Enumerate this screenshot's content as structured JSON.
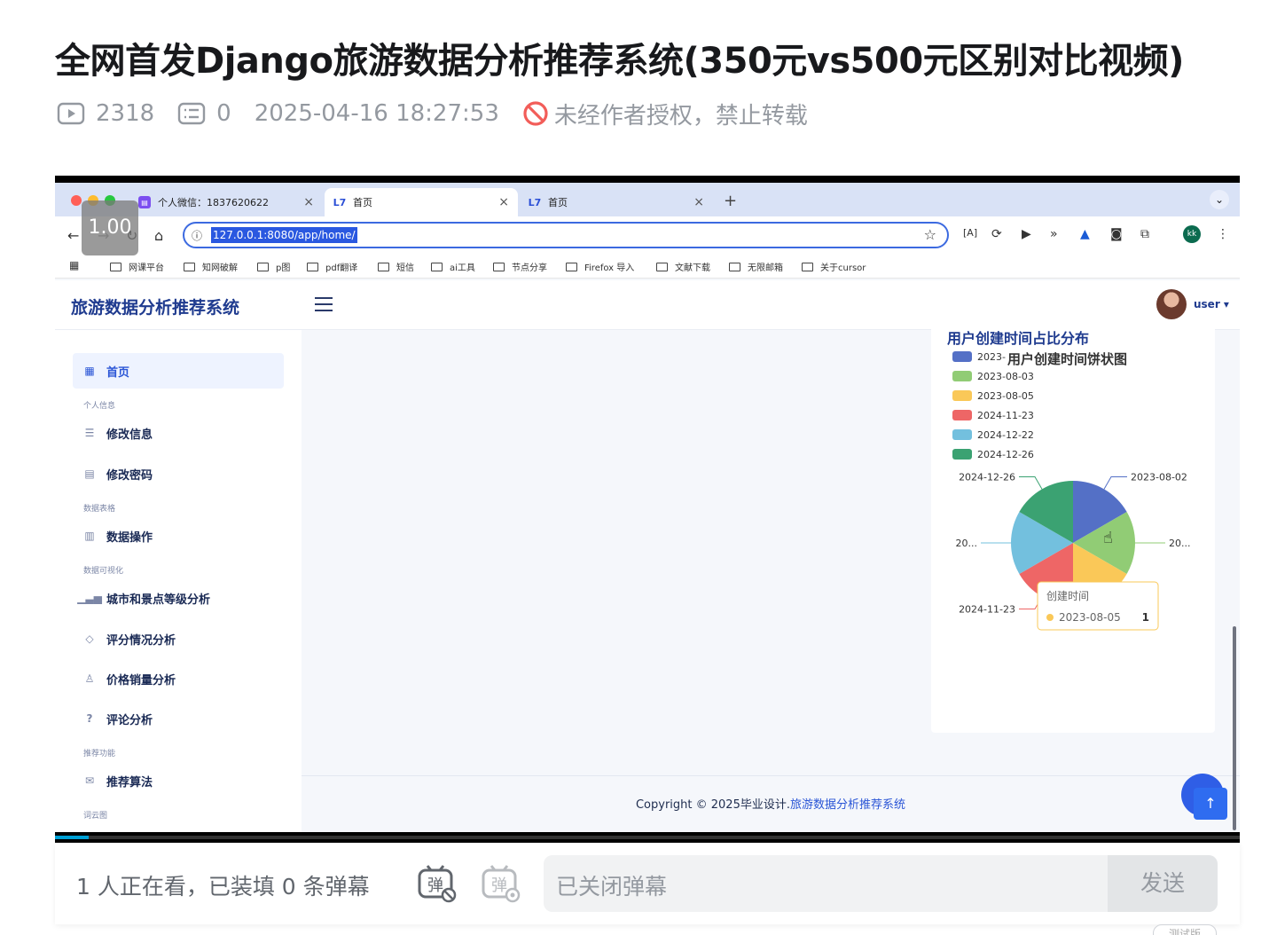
{
  "video": {
    "title": "全网首发Django旅游数据分析推荐系统(350元vs500元区别对比视频)",
    "views": "2318",
    "danmaku_count": "0",
    "datetime": "2025-04-16 18:27:53",
    "notice": "未经作者授权，禁止转载"
  },
  "browser": {
    "tabs": [
      {
        "label": "个人微信：1837620622",
        "close": "×"
      },
      {
        "label": "首页",
        "close": "×"
      },
      {
        "label": "首页",
        "close": "×"
      }
    ],
    "new_tab": "+",
    "url": "127.0.0.1:8080/app/home/",
    "speed": "1.00",
    "profile": "kk",
    "bookmarks": [
      "网课平台",
      "知网破解",
      "p图",
      "pdf翻译",
      "短信",
      "ai工具",
      "节点分享",
      "Firefox 导入",
      "文献下载",
      "无限邮箱",
      "关于cursor"
    ]
  },
  "app": {
    "name": "旅游数据分析推荐系统",
    "user": "user ▾",
    "sidebar": {
      "home": "首页",
      "sec_personal": "个人信息",
      "edit_info": "修改信息",
      "edit_password": "修改密码",
      "sec_table": "数据表格",
      "data_ops": "数据操作",
      "sec_vis": "数据可视化",
      "city_level": "城市和景点等级分析",
      "rating": "评分情况分析",
      "price_sales": "价格销量分析",
      "comments": "评论分析",
      "sec_recommend": "推荐功能",
      "recommend_algo": "推荐算法",
      "sec_wordcloud": "词云图"
    },
    "card_title": "用户创建时间占比分布",
    "copyright_prefix": "Copyright © 2025毕业设计.",
    "copyright_link": "旅游数据分析推荐系统"
  },
  "chart_data": {
    "type": "pie",
    "title": "用户创建时间饼状图",
    "categories": [
      "2023-08-02",
      "2023-08-03",
      "2023-08-05",
      "2024-11-23",
      "2024-12-22",
      "2024-12-26"
    ],
    "values": [
      1,
      1,
      1,
      1,
      1,
      1
    ],
    "colors": [
      "#5470c6",
      "#91cc75",
      "#fac858",
      "#ee6666",
      "#73c0de",
      "#3ba272"
    ],
    "legend_labels": [
      "2023-",
      "2023-08-03",
      "2023-08-05",
      "2024-11-23",
      "2024-12-22",
      "2024-12-26"
    ],
    "slice_labels": [
      "2023-08-02",
      "20...",
      "08-05",
      "2024-11-23",
      "20...",
      "2024-12-26"
    ],
    "legend_position": "top-left",
    "tooltip": {
      "title": "创建时间",
      "label": "2023-08-05",
      "value": "1"
    }
  },
  "danmaku": {
    "viewers_text": "1 人正在看，已装填 0 条弹幕",
    "placeholder": "已关闭弹幕",
    "send": "发送",
    "icon_on": "弹",
    "icon_settings": "弹"
  },
  "corner_tag": "测试版"
}
